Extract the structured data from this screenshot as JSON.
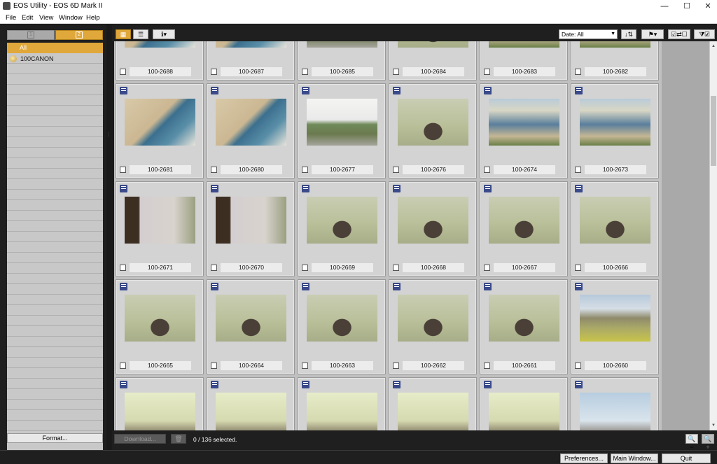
{
  "window": {
    "title": "EOS Utility - EOS 6D Mark II",
    "minimize": "—",
    "maximize": "☐",
    "close": "✕"
  },
  "menu": [
    "File",
    "Edit",
    "View",
    "Window",
    "Help"
  ],
  "slots": [
    {
      "label": "1",
      "active": false
    },
    {
      "label": "2",
      "active": true
    }
  ],
  "folders": {
    "all_label": "All",
    "items": [
      "100CANON"
    ]
  },
  "left": {
    "format_label": "Format..."
  },
  "toolbar": {
    "grid_view_icon": "grid-icon",
    "list_view_icon": "list-icon",
    "info_icon": "info-icon",
    "info_label": "ℹ▾",
    "sort_value": "Date: All",
    "sort_order_label": "↓⇅",
    "rating_label": "⚑▾",
    "check_label": "☑⇄☐",
    "filter_label": "⧩☑"
  },
  "thumbnails": [
    {
      "name": "100-2688",
      "badge": "JPG RAW",
      "kind": "beach"
    },
    {
      "name": "100-2687",
      "badge": "JPG RAW",
      "kind": "beach"
    },
    {
      "name": "100-2685",
      "badge": "JPG RAW",
      "kind": "road"
    },
    {
      "name": "100-2684",
      "badge": "JPG RAW",
      "kind": "bird"
    },
    {
      "name": "100-2683",
      "badge": "JPG RAW",
      "kind": "coast"
    },
    {
      "name": "100-2682",
      "badge": "JPG RAW",
      "kind": "coast"
    },
    {
      "name": "100-2681",
      "badge": "JPG RAW",
      "kind": "beach"
    },
    {
      "name": "100-2680",
      "badge": "JPG RAW",
      "kind": "beach"
    },
    {
      "name": "100-2677",
      "badge": "JPG RAW",
      "kind": "road"
    },
    {
      "name": "100-2676",
      "badge": "JPG RAW",
      "kind": "bird"
    },
    {
      "name": "100-2674",
      "badge": "JPG RAW",
      "kind": "coast"
    },
    {
      "name": "100-2673",
      "badge": "JPG RAW",
      "kind": "coast"
    },
    {
      "name": "100-2671",
      "badge": "JPG RAW",
      "kind": "tree"
    },
    {
      "name": "100-2670",
      "badge": "JPG RAW",
      "kind": "tree"
    },
    {
      "name": "100-2669",
      "badge": "JPG RAW",
      "kind": "bird"
    },
    {
      "name": "100-2668",
      "badge": "JPG RAW",
      "kind": "bird"
    },
    {
      "name": "100-2667",
      "badge": "JPG RAW",
      "kind": "bird"
    },
    {
      "name": "100-2666",
      "badge": "JPG RAW",
      "kind": "bird"
    },
    {
      "name": "100-2665",
      "badge": "JPG RAW",
      "kind": "bird"
    },
    {
      "name": "100-2664",
      "badge": "JPG RAW",
      "kind": "bird"
    },
    {
      "name": "100-2663",
      "badge": "JPG RAW",
      "kind": "bird"
    },
    {
      "name": "100-2662",
      "badge": "JPG RAW",
      "kind": "bird"
    },
    {
      "name": "100-2661",
      "badge": "JPG RAW",
      "kind": "bird"
    },
    {
      "name": "100-2660",
      "badge": "JPG RAW",
      "kind": "hills"
    },
    {
      "name": "",
      "badge": "JPG RAW",
      "kind": "partial"
    },
    {
      "name": "",
      "badge": "JPG RAW",
      "kind": "partial"
    },
    {
      "name": "",
      "badge": "JPG RAW",
      "kind": "partial"
    },
    {
      "name": "",
      "badge": "JPG RAW",
      "kind": "partial"
    },
    {
      "name": "",
      "badge": "JPG RAW",
      "kind": "partial"
    },
    {
      "name": "",
      "badge": "JPG RAW",
      "kind": "sky"
    }
  ],
  "bottom": {
    "download_label": "Download...",
    "trash_label": "🗑",
    "selected_text": "0 / 136  selected.",
    "zoom_out_label": "🔍−",
    "zoom_in_label": "🔍+"
  },
  "footer": {
    "preferences_label": "Preferences...",
    "main_window_label": "Main Window...",
    "quit_label": "Quit"
  },
  "colors": {
    "accent": "#e0a83a",
    "panel": "#1f1f1f",
    "grid_bg": "#c0c0c0"
  }
}
